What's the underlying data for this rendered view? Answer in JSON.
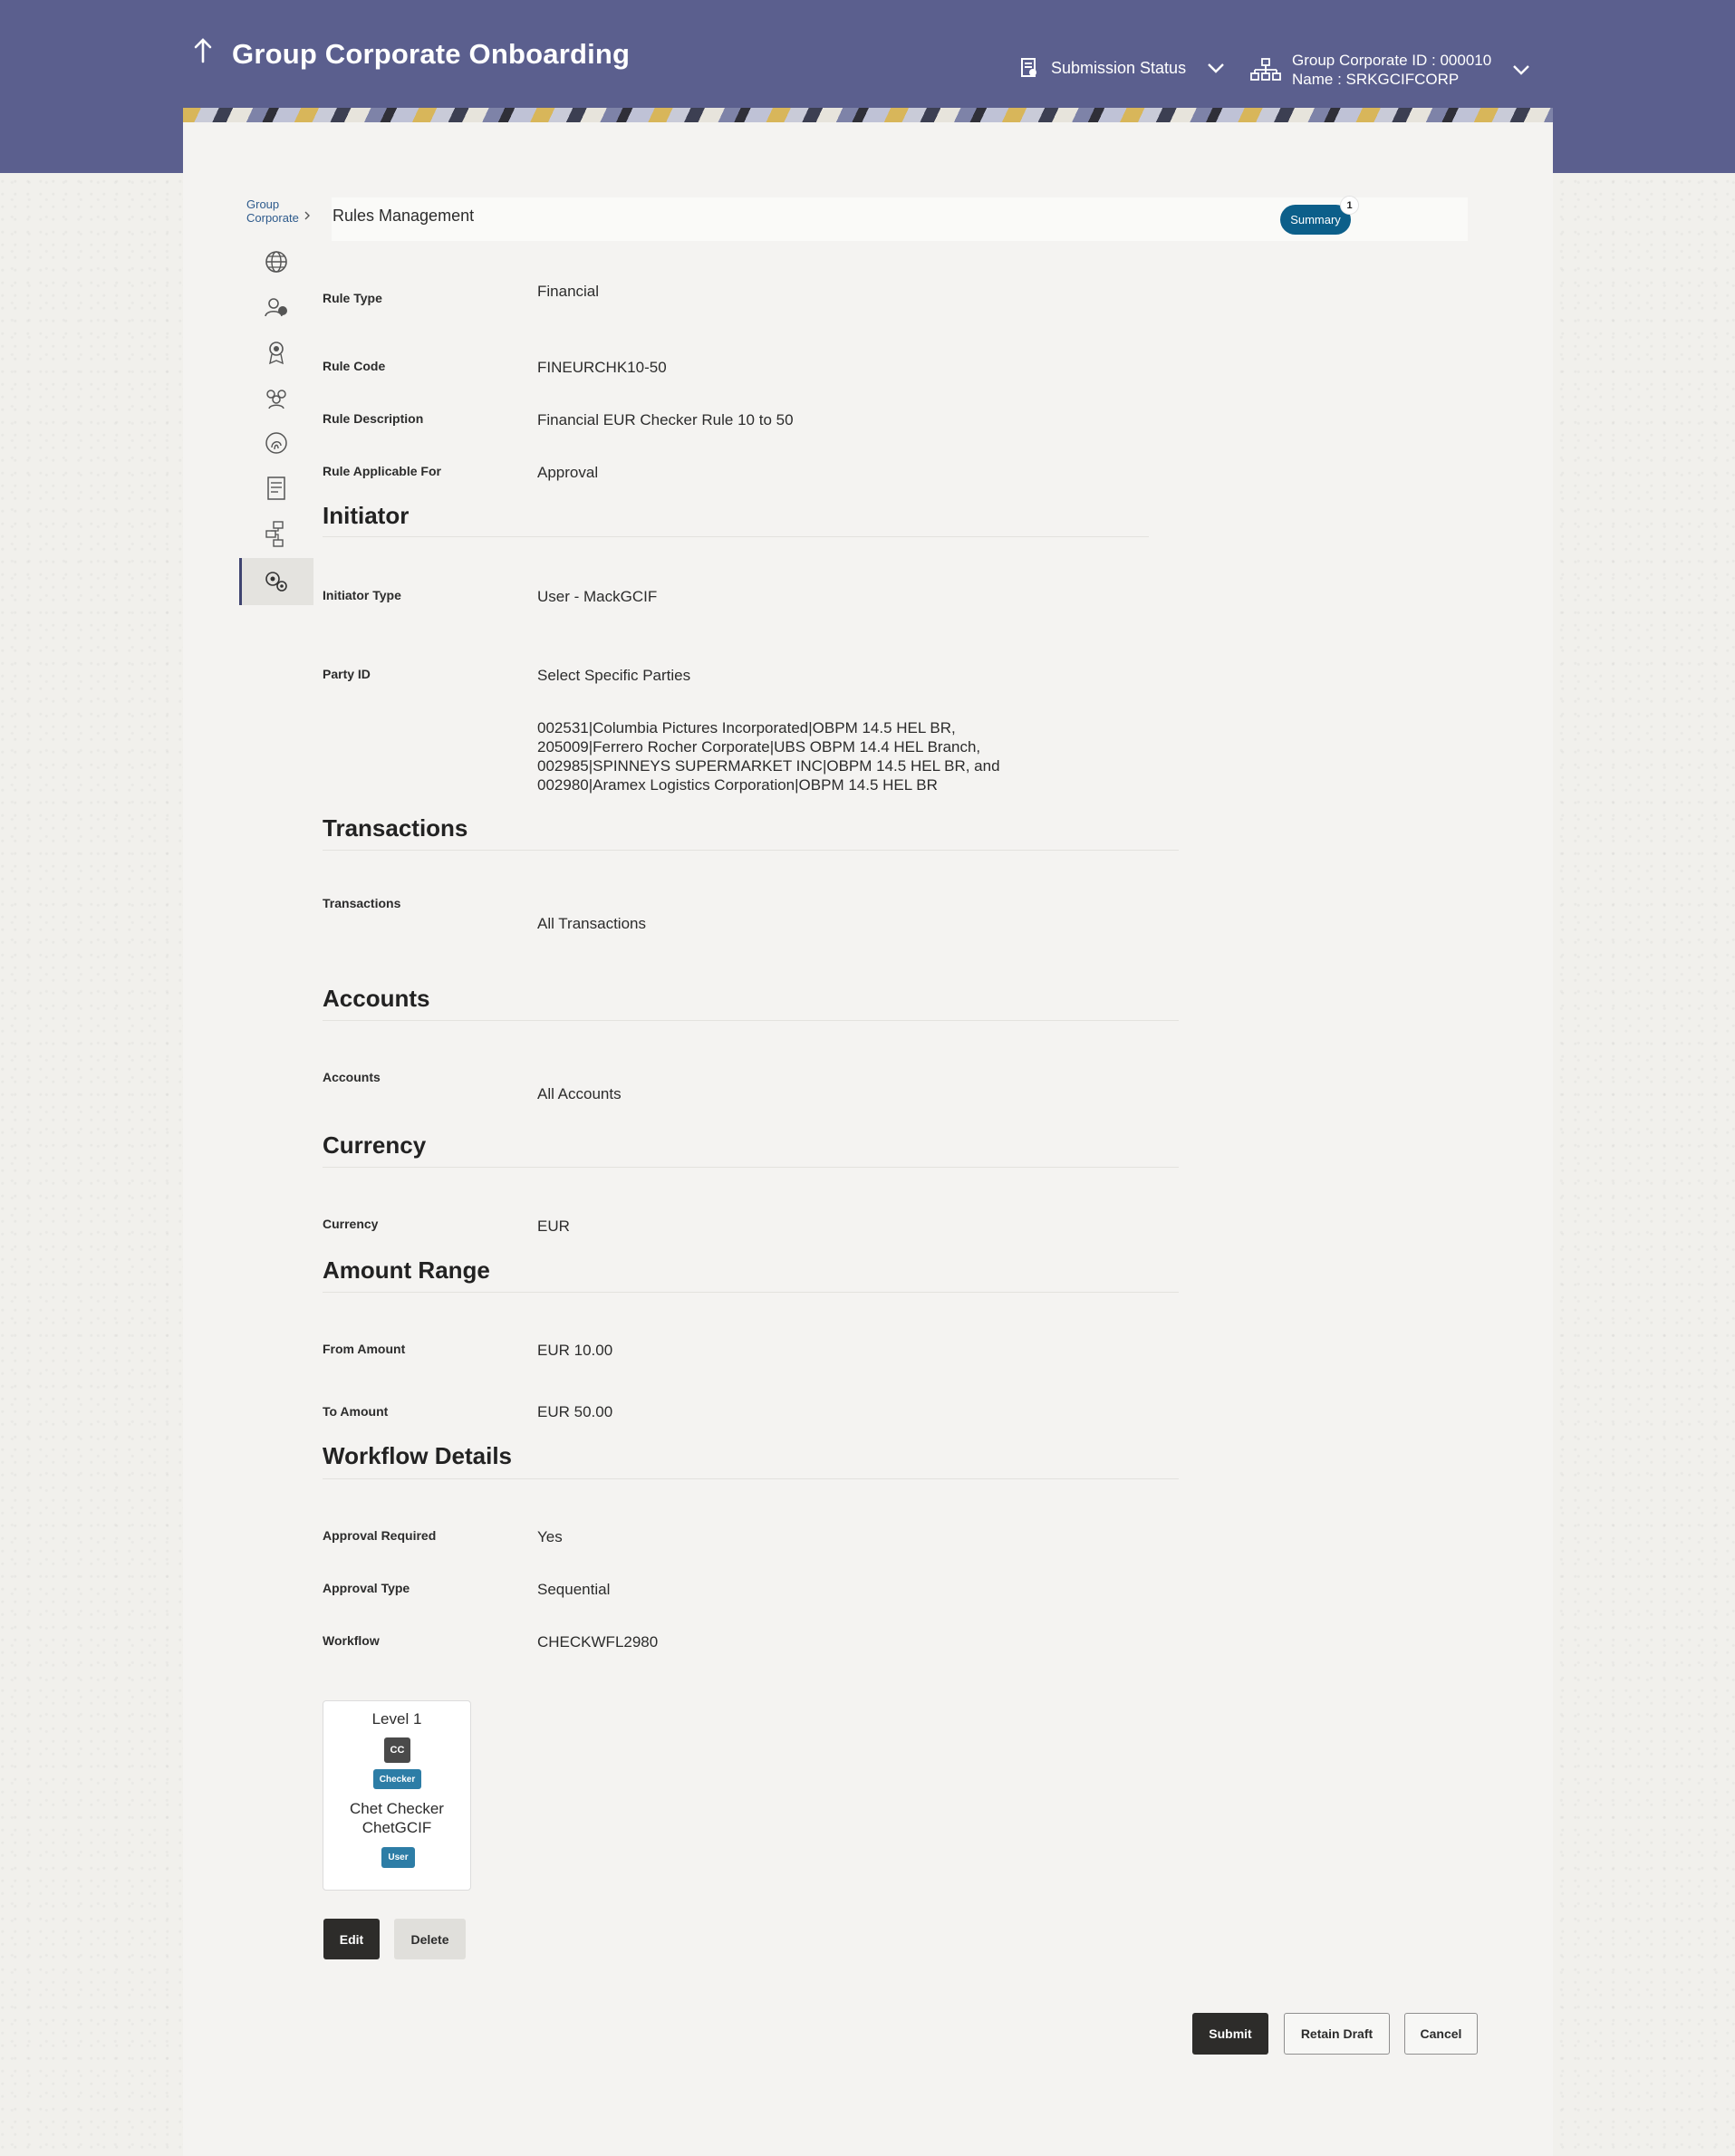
{
  "header": {
    "title": "Group Corporate Onboarding",
    "submission_status": "Submission Status",
    "corporate_id": "Group Corporate ID : 000010",
    "corporate_name": "Name : SRKGCIFCORP"
  },
  "breadcrumb": {
    "line1": "Group",
    "line2": "Corporate"
  },
  "page": {
    "title": "Rules Management",
    "summary_label": "Summary",
    "summary_count": "1"
  },
  "nav": {
    "icons": [
      "globe-icon",
      "user-settings-icon",
      "badge-icon",
      "group-icon",
      "fingerprint-icon",
      "document-icon",
      "workflow-icon",
      "rules-icon"
    ]
  },
  "rule": {
    "rule_type_label": "Rule Type",
    "rule_type": "Financial",
    "rule_code_label": "Rule Code",
    "rule_code": "FINEURCHK10-50",
    "rule_desc_label": "Rule Description",
    "rule_desc": "Financial EUR Checker Rule 10 to 50",
    "applicable_label": "Rule Applicable For",
    "applicable": "Approval"
  },
  "initiator": {
    "title": "Initiator",
    "type_label": "Initiator Type",
    "type": "User - MackGCIF",
    "party_label": "Party ID",
    "party": "Select Specific Parties",
    "party_list": [
      "002531|Columbia Pictures Incorporated|OBPM 14.5 HEL BR,",
      "205009|Ferrero Rocher Corporate|UBS OBPM 14.4 HEL Branch,",
      "002985|SPINNEYS SUPERMARKET INC|OBPM 14.5 HEL BR, and",
      "002980|Aramex Logistics Corporation|OBPM 14.5 HEL BR"
    ]
  },
  "transactions": {
    "title": "Transactions",
    "label": "Transactions",
    "value": "All Transactions"
  },
  "accounts": {
    "title": "Accounts",
    "label": "Accounts",
    "value": "All Accounts"
  },
  "currency": {
    "title": "Currency",
    "label": "Currency",
    "value": "EUR"
  },
  "amount": {
    "title": "Amount Range",
    "from_label": "From Amount",
    "from": "EUR 10.00",
    "to_label": "To Amount",
    "to": "EUR 50.00"
  },
  "workflow": {
    "title": "Workflow Details",
    "approval_required_label": "Approval Required",
    "approval_required": "Yes",
    "approval_type_label": "Approval Type",
    "approval_type": "Sequential",
    "workflow_label": "Workflow",
    "workflow": "CHECKWFL2980",
    "level": {
      "title": "Level 1",
      "initials": "CC",
      "role": "Checker",
      "name": "Chet Checker",
      "user_id": "ChetGCIF",
      "user_type": "User"
    }
  },
  "actions": {
    "edit": "Edit",
    "delete": "Delete",
    "submit": "Submit",
    "retain_draft": "Retain Draft",
    "cancel": "Cancel"
  },
  "colors": {
    "header": "#5b5f8e",
    "accent": "#0c5f8a",
    "chip": "#2d7da6",
    "primary_button": "#2d2c2a"
  }
}
